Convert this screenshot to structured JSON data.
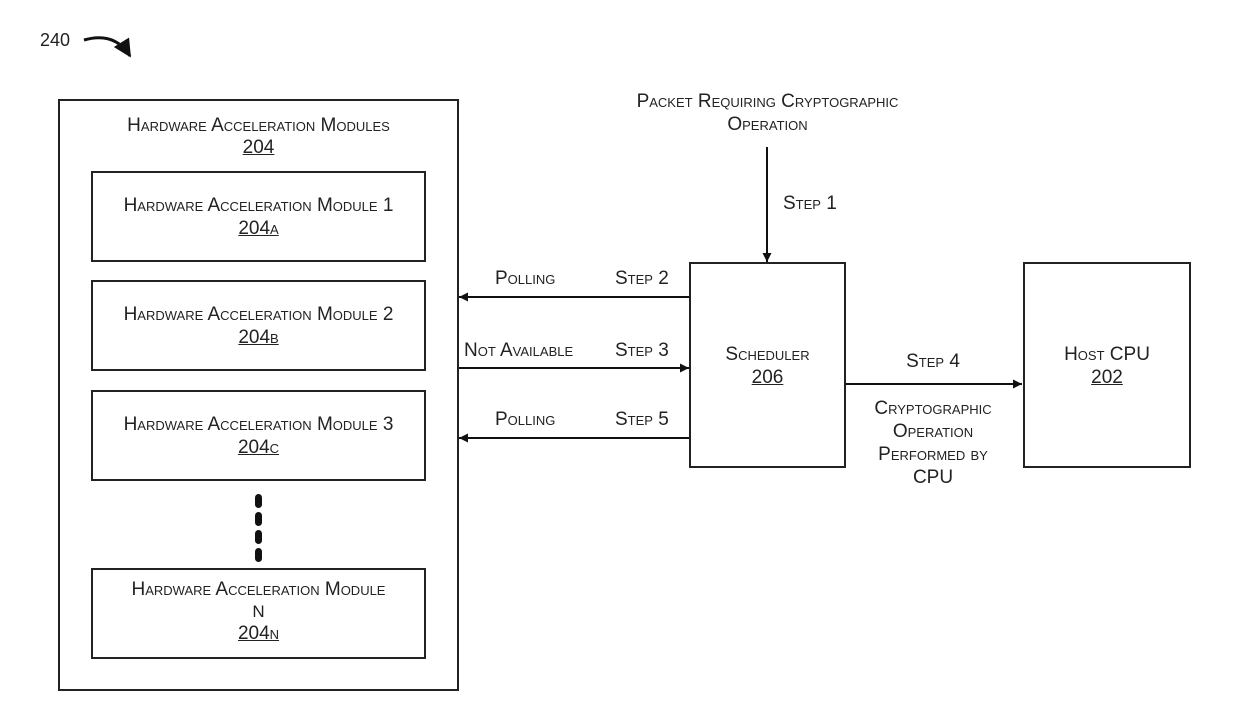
{
  "figure_ref": "240",
  "hw_modules_group": {
    "title": "Hardware Acceleration Modules",
    "ref": "204",
    "modules": [
      {
        "title": "Hardware Acceleration Module 1",
        "ref": "204a"
      },
      {
        "title": "Hardware Acceleration Module 2",
        "ref": "204b"
      },
      {
        "title": "Hardware Acceleration Module 3",
        "ref": "204c"
      },
      {
        "title": "Hardware Acceleration Module",
        "title_line2": "N",
        "ref": "204n"
      }
    ]
  },
  "scheduler": {
    "title": "Scheduler",
    "ref": "206"
  },
  "host_cpu": {
    "title": "Host CPU",
    "ref": "202"
  },
  "input": {
    "line1": "Packet Requiring Cryptographic",
    "line2": "Operation"
  },
  "steps": {
    "step1": {
      "label": "Step 1"
    },
    "step2": {
      "label": "Step 2",
      "action": "Polling"
    },
    "step3": {
      "label": "Step 3",
      "action": "Not Available"
    },
    "step4": {
      "label": "Step 4",
      "desc_lines": [
        "Cryptographic",
        "Operation",
        "Performed by",
        "CPU"
      ]
    },
    "step5": {
      "label": "Step 5",
      "action": "Polling"
    }
  }
}
